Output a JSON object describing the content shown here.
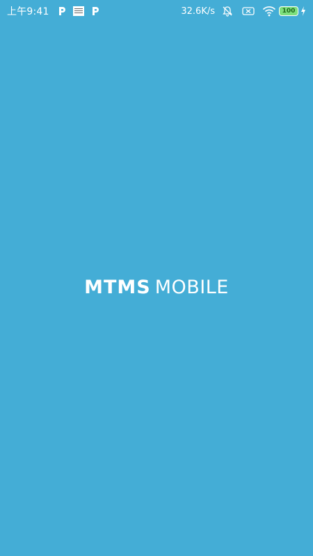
{
  "status_bar": {
    "time": "上午9:41",
    "network_speed": "32.6K/s",
    "battery_level": "100",
    "icons": [
      "p-icon",
      "news-icon",
      "p-icon",
      "notifications-off-icon",
      "no-sim-icon",
      "wifi-icon",
      "battery-icon",
      "charging-icon"
    ]
  },
  "splash": {
    "logo_primary": "MTMS",
    "logo_secondary": "MOBILE",
    "background_color": "#44add6"
  }
}
